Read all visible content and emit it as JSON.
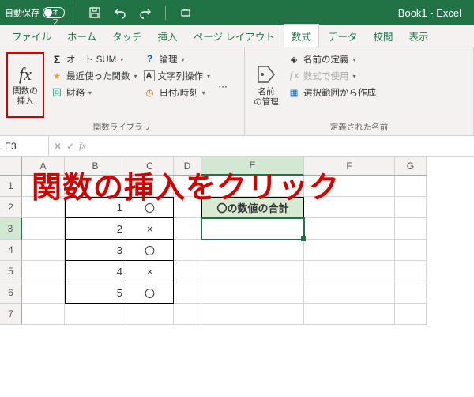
{
  "titlebar": {
    "autosave": "自動保存",
    "toggle": "オフ",
    "book": "Book1  -  Excel"
  },
  "tabs": [
    "ファイル",
    "ホーム",
    "タッチ",
    "挿入",
    "ページ レイアウト",
    "数式",
    "データ",
    "校閲",
    "表示"
  ],
  "activeTab": 5,
  "ribbon": {
    "fx": {
      "label": "関数の\n挿入"
    },
    "lib": {
      "autosum": "オート SUM",
      "recent": "最近使った関数",
      "financial": "財務",
      "logical": "論理",
      "text": "文字列操作",
      "datetime": "日付/時刻",
      "groupLabel": "関数ライブラリ"
    },
    "names": {
      "manager": "名前\nの管理",
      "define": "名前の定義",
      "useIn": "数式で使用",
      "fromSel": "選択範囲から作成",
      "groupLabel": "定義された名前"
    }
  },
  "fbar": {
    "cellRef": "E3",
    "formula": ""
  },
  "columns": [
    "A",
    "B",
    "C",
    "D",
    "E",
    "F",
    "G"
  ],
  "rows": [
    "1",
    "2",
    "3",
    "4",
    "5",
    "6",
    "7"
  ],
  "cells": {
    "B2": "1",
    "C2": "〇",
    "B3": "2",
    "C3": "×",
    "B4": "3",
    "C4": "〇",
    "B5": "4",
    "C5": "×",
    "B6": "5",
    "C6": "〇",
    "E2": "〇の数値の合計"
  },
  "annotation": "関数の挿入をクリック",
  "chart_data": {
    "type": "table",
    "columns": [
      "B",
      "C"
    ],
    "rows": [
      [
        1,
        "〇"
      ],
      [
        2,
        "×"
      ],
      [
        3,
        "〇"
      ],
      [
        4,
        "×"
      ],
      [
        5,
        "〇"
      ]
    ],
    "header_E2": "〇の数値の合計"
  }
}
